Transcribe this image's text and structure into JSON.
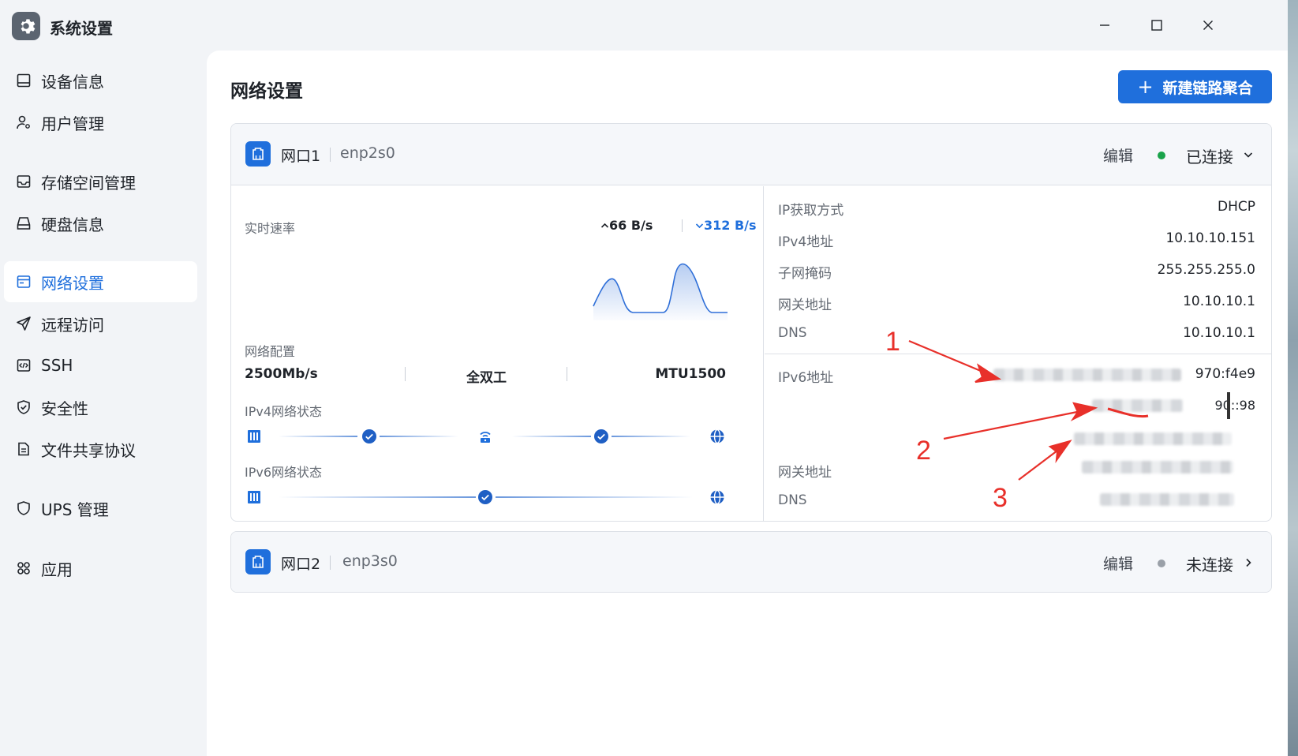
{
  "window": {
    "title": "系统设置",
    "logo_icon": "gear-icon",
    "controls": [
      "minimize-icon",
      "maximize-icon",
      "close-icon"
    ]
  },
  "sidebar": {
    "items": [
      {
        "label": "设备信息",
        "icon": "monitor-icon",
        "active": false
      },
      {
        "label": "用户管理",
        "icon": "user-gear-icon",
        "active": false
      },
      {
        "label": "存储空间管理",
        "icon": "inbox-icon",
        "active": false
      },
      {
        "label": "硬盘信息",
        "icon": "disk-icon",
        "active": false
      },
      {
        "label": "网络设置",
        "icon": "window-icon",
        "active": true
      },
      {
        "label": "远程访问",
        "icon": "send-icon",
        "active": false
      },
      {
        "label": "SSH",
        "icon": "code-icon",
        "active": false
      },
      {
        "label": "安全性",
        "icon": "shield-check-icon",
        "active": false
      },
      {
        "label": "文件共享协议",
        "icon": "document-icon",
        "active": false
      },
      {
        "label": "UPS 管理",
        "icon": "shield-icon",
        "active": false
      },
      {
        "label": "应用",
        "icon": "apps-icon",
        "active": false
      }
    ]
  },
  "main": {
    "title": "网络设置",
    "new_aggregation_button": {
      "plus": "+",
      "label": "新建链路聚合"
    }
  },
  "ports": [
    {
      "name": "网口1",
      "device": "enp2s0",
      "edit_label": "编辑",
      "status": "已连接",
      "status_color": "#1aa34a",
      "expanded": true,
      "realtime": {
        "label": "实时速率",
        "up": "66 B/s",
        "down": "312 B/s"
      },
      "config": {
        "label": "网络配置",
        "speed": "2500Mb/s",
        "duplex": "全双工",
        "mtu": "MTU1500"
      },
      "ipv4_status_label": "IPv4网络状态",
      "ipv6_status_label": "IPv6网络状态",
      "details": {
        "ip_method": {
          "label": "IP获取方式",
          "value": "DHCP"
        },
        "ipv4": {
          "label": "IPv4地址",
          "value": "10.10.10.151"
        },
        "netmask": {
          "label": "子网掩码",
          "value": "255.255.255.0"
        },
        "gateway": {
          "label": "网关地址",
          "value": "10.10.10.1"
        },
        "dns": {
          "label": "DNS",
          "value": "10.10.10.1"
        },
        "ipv6": {
          "label": "IPv6地址",
          "value_1_visible": "970:f4e9",
          "value_2_visible": "90::98"
        },
        "ipv6_gateway": {
          "label": "网关地址"
        },
        "ipv6_dns": {
          "label": "DNS"
        }
      }
    },
    {
      "name": "网口2",
      "device": "enp3s0",
      "edit_label": "编辑",
      "status": "未连接",
      "status_color": "#9aa0a8",
      "expanded": false
    }
  ],
  "annotations": {
    "labels": [
      "1",
      "2",
      "3"
    ],
    "color": "#e8302a"
  },
  "colors": {
    "accent": "#1f6fdc",
    "connected": "#1aa34a",
    "disconnected": "#9aa0a8"
  }
}
